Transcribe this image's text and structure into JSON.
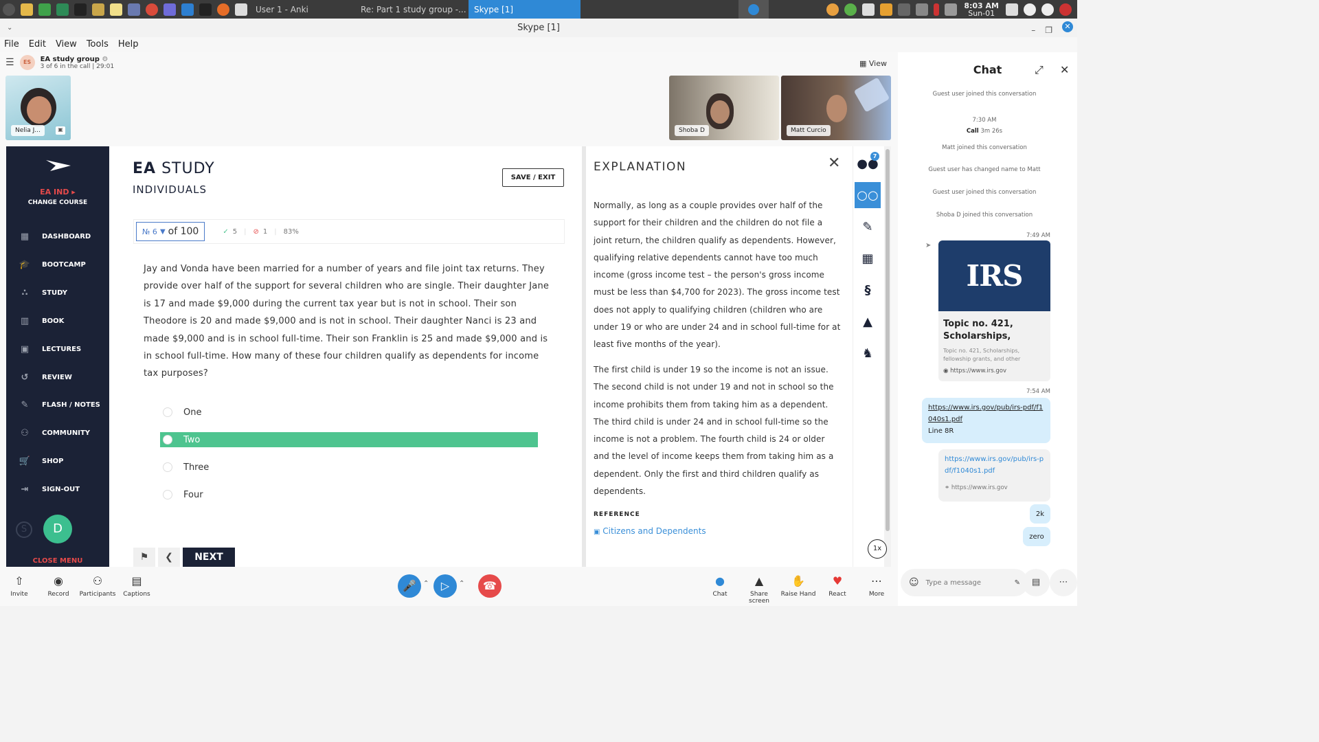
{
  "taskbar": {
    "tasks": [
      {
        "label": "User 1 - Anki"
      },
      {
        "label": "Re: Part 1 study group -..."
      },
      {
        "label": "Skype [1]"
      }
    ],
    "clock_time": "8:03 AM",
    "clock_day": "Sun-01"
  },
  "window": {
    "title": "Skype [1]",
    "menu": [
      "File",
      "Edit",
      "View",
      "Tools",
      "Help"
    ]
  },
  "call": {
    "group_initials": "ES",
    "group_name": "EA study group",
    "status": "3 of 6 in the call | 29:01",
    "view_label": "View",
    "participants": [
      {
        "name": "Nelia J..."
      },
      {
        "name": "Shoba D"
      },
      {
        "name": "Matt Curcio"
      }
    ]
  },
  "study_app": {
    "course_label": "EA IND ▸",
    "change_course": "CHANGE COURSE",
    "nav": [
      {
        "label": "DASHBOARD",
        "icon": "dashboard-icon",
        "glyph": "▦"
      },
      {
        "label": "BOOTCAMP",
        "icon": "graduation-cap-icon",
        "glyph": "🎓"
      },
      {
        "label": "STUDY",
        "icon": "study-icon",
        "glyph": "∴"
      },
      {
        "label": "BOOK",
        "icon": "book-icon",
        "glyph": "▥"
      },
      {
        "label": "LECTURES",
        "icon": "lectures-icon",
        "glyph": "▣"
      },
      {
        "label": "REVIEW",
        "icon": "review-icon",
        "glyph": "↺"
      },
      {
        "label": "FLASH / NOTES",
        "icon": "flash-notes-icon",
        "glyph": "✎"
      },
      {
        "label": "COMMUNITY",
        "icon": "community-icon",
        "glyph": "⚇"
      },
      {
        "label": "SHOP",
        "icon": "shop-icon",
        "glyph": "🛒"
      },
      {
        "label": "SIGN-OUT",
        "icon": "sign-out-icon",
        "glyph": "⇥"
      }
    ],
    "user_initial": "D",
    "skype_initial": "S",
    "close_menu": "CLOSE MENU",
    "title_bold": "EA",
    "title_rest": "STUDY",
    "subtitle": "INDIVIDUALS",
    "save_exit": "SAVE / EXIT",
    "question_number_prefix": "№ 6",
    "question_total": "of 100",
    "correct_count": "5",
    "wrong_count": "1",
    "score": "83%",
    "question": "Jay and Vonda have been married for a number of years and file joint tax returns. They provide over half of the support for several children who are single. Their daughter Jane is 17 and made $9,000 during the current tax year but is not in school. Their son Theodore is 20 and made $9,000 and is not in school. Their daughter Nanci is 23 and made $9,000 and is in school full-time. Their son Franklin is 25 and made $9,000 and is in school full-time. How many of these four children qualify as dependents for income tax purposes?",
    "answers": [
      {
        "label": "One",
        "selected": false
      },
      {
        "label": "Two",
        "selected": true
      },
      {
        "label": "Three",
        "selected": false
      },
      {
        "label": "Four",
        "selected": false
      }
    ],
    "next_label": "NEXT",
    "explanation": {
      "title": "EXPLANATION",
      "para1": "Normally, as long as a couple provides over half of the support for their children and the children do not file a joint return, the children qualify as dependents. However, qualifying relative dependents cannot have too much income (gross income test – the person's gross income must be less than $4,700 for 2023). The gross income test does not apply to qualifying children (children who are under 19 or who are under 24 and in school full-time for at least five months of the year).",
      "para2": "The first child is under 19 so the income is not an issue. The second child is not under 19 and not in school so the income prohibits them from taking him as a dependent. The third child is under 24 and in school full-time so the income is not a problem. The fourth child is 24 or older and the level of income keeps them from taking him as a dependent. Only the first and third children qualify as dependents.",
      "reference_label": "REFERENCE",
      "reference_link": "Citizens and Dependents"
    },
    "tools_badge": "7",
    "speed": "1x"
  },
  "callbar": {
    "invite": "Invite",
    "record": "Record",
    "participants": "Participants",
    "captions": "Captions",
    "chat": "Chat",
    "share_screen": "Share screen",
    "raise_hand": "Raise Hand",
    "react": "React",
    "more": "More"
  },
  "chat": {
    "title": "Chat",
    "sys1": "Guest user joined this conversation",
    "time1": "7:30 AM",
    "call_label": "Call",
    "call_duration": "3m 26s",
    "sys2": "Matt joined this conversation",
    "sys3": "Guest user has changed name to Matt",
    "sys4": "Guest user joined this conversation",
    "sys5": "Shoba D joined this conversation",
    "time2": "7:49 AM",
    "card_logo": "IRS",
    "card_title": "Topic no. 421, Scholarships,",
    "card_desc": "Topic no. 421, Scholarships, fellowship grants, and other",
    "card_url": "https://www.irs.gov",
    "time3": "7:54 AM",
    "msg1_link": "https://www.irs.gov/pub/irs-pdf/f1040s1.pdf",
    "msg1_text": "Line 8R",
    "msg2_link": "https://www.irs.gov/pub/irs-pdf/f1040s1.pdf",
    "msg2_url": "https://www.irs.gov",
    "msg3": "2k",
    "msg4": "zero",
    "composer_placeholder": "Type a message"
  },
  "colors": {
    "sidebar": "#1b2236",
    "accent_red": "#e64a4a",
    "selected_answer": "#4ec48f",
    "skype_blue": "#2f89d6",
    "link_blue": "#3a8fd8"
  }
}
